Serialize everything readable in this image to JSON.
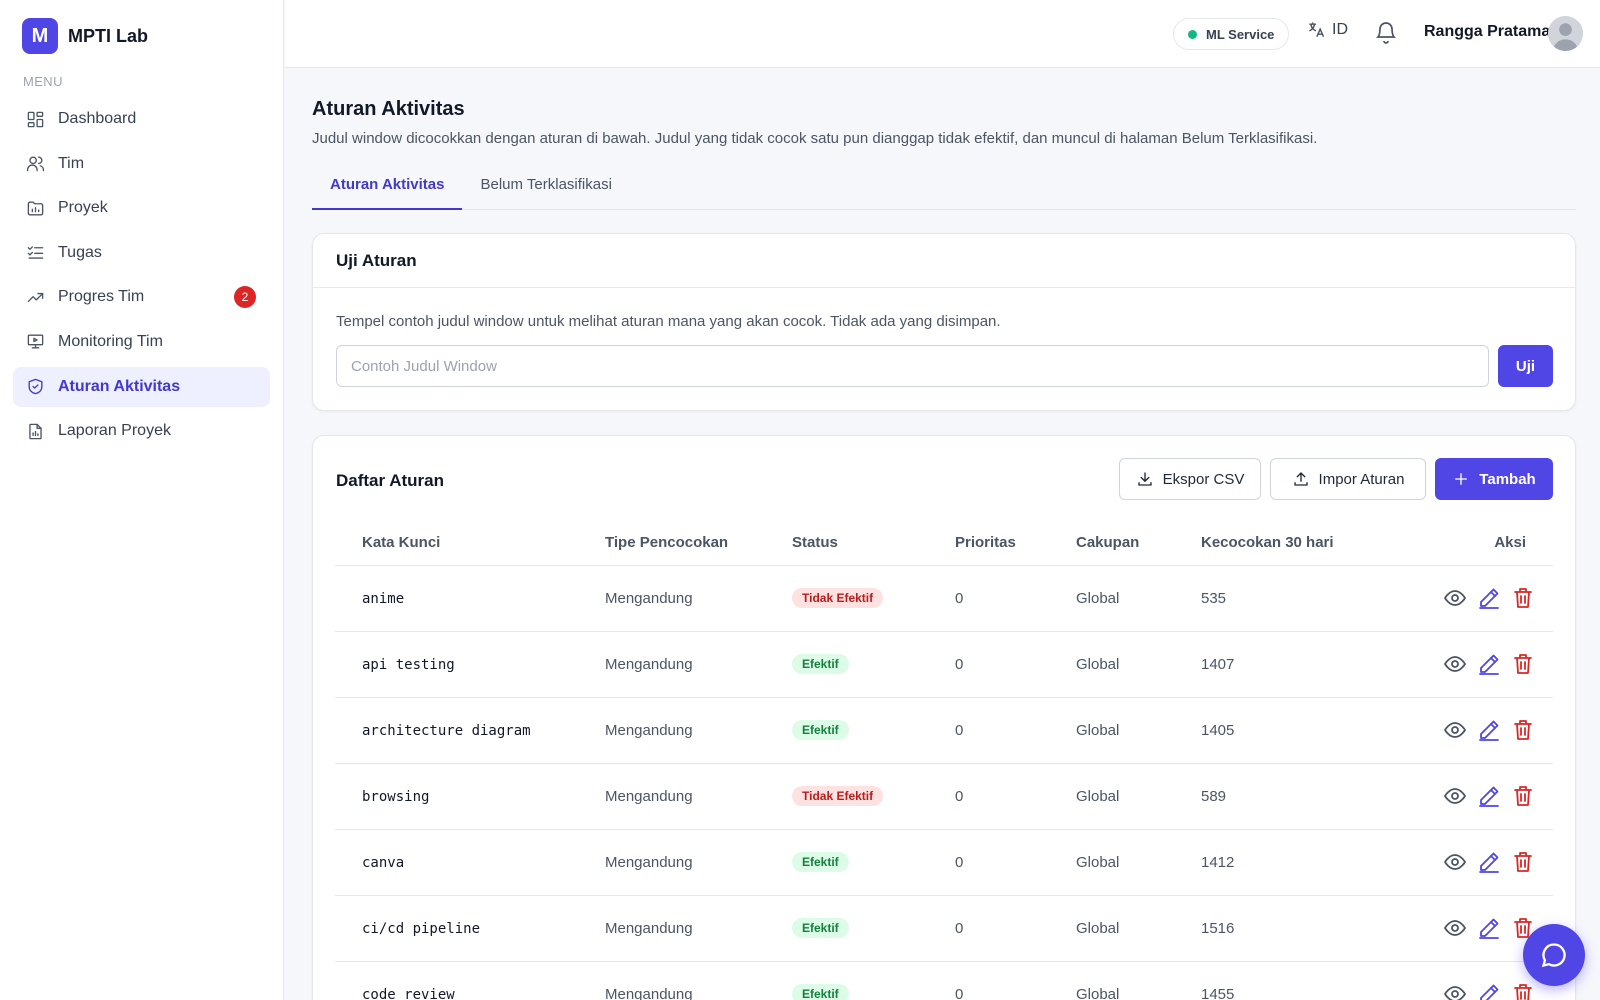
{
  "brand": {
    "logo_letter": "M",
    "name": "MPTI Lab"
  },
  "sidebar": {
    "menu_label": "MENU",
    "items": [
      {
        "label": "Dashboard",
        "icon": "dashboard-icon"
      },
      {
        "label": "Tim",
        "icon": "users-icon"
      },
      {
        "label": "Proyek",
        "icon": "folder-chart-icon"
      },
      {
        "label": "Tugas",
        "icon": "checklist-icon"
      },
      {
        "label": "Progres Tim",
        "icon": "trending-up-icon",
        "badge": "2"
      },
      {
        "label": "Monitoring Tim",
        "icon": "monitor-icon"
      },
      {
        "label": "Aturan Aktivitas",
        "icon": "shield-check-icon",
        "active": true
      },
      {
        "label": "Laporan Proyek",
        "icon": "file-chart-icon"
      }
    ]
  },
  "header": {
    "service_label": "ML Service",
    "service_status_color": "#10b981",
    "language": "ID",
    "user_name": "Rangga Pratama"
  },
  "page": {
    "title": "Aturan Aktivitas",
    "description": "Judul window dicocokkan dengan aturan di bawah. Judul yang tidak cocok satu pun dianggap tidak efektif, dan muncul di halaman Belum Terklasifikasi.",
    "tabs": [
      {
        "label": "Aturan Aktivitas",
        "active": true
      },
      {
        "label": "Belum Terklasifikasi",
        "active": false
      }
    ]
  },
  "test_card": {
    "title": "Uji Aturan",
    "description": "Tempel contoh judul window untuk melihat aturan mana yang akan cocok. Tidak ada yang disimpan.",
    "input_placeholder": "Contoh Judul Window",
    "input_value": "",
    "button_label": "Uji"
  },
  "rules": {
    "title": "Daftar Aturan",
    "export_label": "Ekspor CSV",
    "import_label": "Impor Aturan",
    "add_label": "Tambah",
    "columns": {
      "keyword": "Kata Kunci",
      "match_type": "Tipe Pencocokan",
      "status": "Status",
      "priority": "Prioritas",
      "scope": "Cakupan",
      "matches": "Kecocokan 30 hari",
      "actions": "Aksi"
    },
    "rows": [
      {
        "keyword": "anime",
        "match_type": "Mengandung",
        "status": "Tidak Efektif",
        "effective": false,
        "priority": "0",
        "scope": "Global",
        "matches": "535"
      },
      {
        "keyword": "api testing",
        "match_type": "Mengandung",
        "status": "Efektif",
        "effective": true,
        "priority": "0",
        "scope": "Global",
        "matches": "1407"
      },
      {
        "keyword": "architecture diagram",
        "match_type": "Mengandung",
        "status": "Efektif",
        "effective": true,
        "priority": "0",
        "scope": "Global",
        "matches": "1405"
      },
      {
        "keyword": "browsing",
        "match_type": "Mengandung",
        "status": "Tidak Efektif",
        "effective": false,
        "priority": "0",
        "scope": "Global",
        "matches": "589"
      },
      {
        "keyword": "canva",
        "match_type": "Mengandung",
        "status": "Efektif",
        "effective": true,
        "priority": "0",
        "scope": "Global",
        "matches": "1412"
      },
      {
        "keyword": "ci/cd pipeline",
        "match_type": "Mengandung",
        "status": "Efektif",
        "effective": true,
        "priority": "0",
        "scope": "Global",
        "matches": "1516"
      },
      {
        "keyword": "code review",
        "match_type": "Mengandung",
        "status": "Efektif",
        "effective": true,
        "priority": "0",
        "scope": "Global",
        "matches": "1455"
      }
    ]
  },
  "colors": {
    "accent": "#4f46e5",
    "effective_bg": "#dcfce7",
    "effective_text": "#15803d",
    "ineffective_bg": "#fee2e2",
    "ineffective_text": "#b91c1c"
  }
}
